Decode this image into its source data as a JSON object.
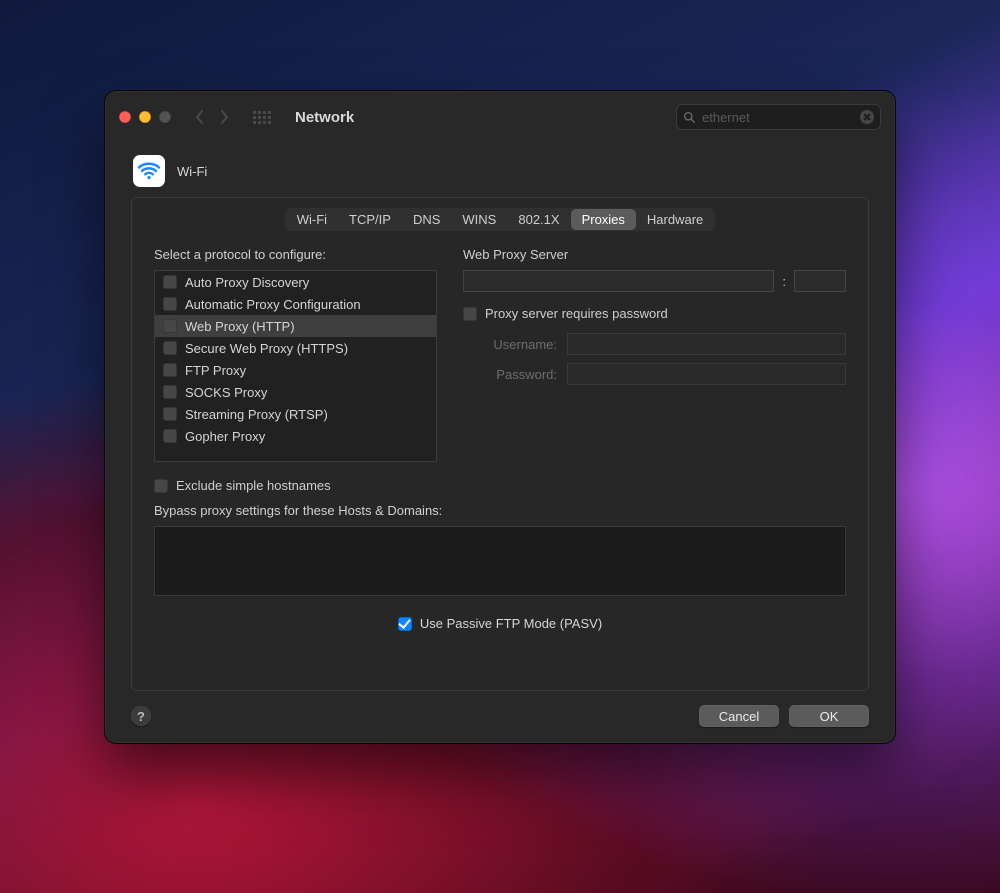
{
  "window": {
    "title": "Network"
  },
  "search": {
    "value": "ethernet"
  },
  "interface": {
    "name": "Wi-Fi"
  },
  "tabs": {
    "items": [
      {
        "label": "Wi-Fi"
      },
      {
        "label": "TCP/IP"
      },
      {
        "label": "DNS"
      },
      {
        "label": "WINS"
      },
      {
        "label": "802.1X"
      },
      {
        "label": "Proxies"
      },
      {
        "label": "Hardware"
      }
    ],
    "selected_index": 5
  },
  "left": {
    "heading": "Select a protocol to configure:",
    "protocols": [
      {
        "label": "Auto Proxy Discovery",
        "checked": false,
        "selected": false
      },
      {
        "label": "Automatic Proxy Configuration",
        "checked": false,
        "selected": false
      },
      {
        "label": "Web Proxy (HTTP)",
        "checked": false,
        "selected": true
      },
      {
        "label": "Secure Web Proxy (HTTPS)",
        "checked": false,
        "selected": false
      },
      {
        "label": "FTP Proxy",
        "checked": false,
        "selected": false
      },
      {
        "label": "SOCKS Proxy",
        "checked": false,
        "selected": false
      },
      {
        "label": "Streaming Proxy (RTSP)",
        "checked": false,
        "selected": false
      },
      {
        "label": "Gopher Proxy",
        "checked": false,
        "selected": false
      }
    ]
  },
  "right": {
    "heading": "Web Proxy Server",
    "host": "",
    "port_separator": ":",
    "port": "",
    "requires_password_label": "Proxy server requires password",
    "requires_password_checked": false,
    "username_label": "Username:",
    "username_value": "",
    "password_label": "Password:",
    "password_value": ""
  },
  "exclude": {
    "checked": false,
    "label": "Exclude simple hostnames"
  },
  "bypass": {
    "label": "Bypass proxy settings for these Hosts & Domains:",
    "value": ""
  },
  "pasv": {
    "checked": true,
    "label": "Use Passive FTP Mode (PASV)"
  },
  "buttons": {
    "cancel": "Cancel",
    "ok": "OK"
  }
}
